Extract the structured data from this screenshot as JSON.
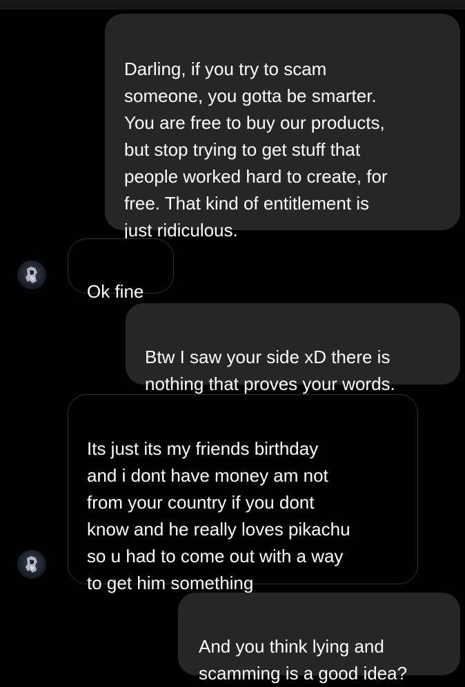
{
  "messages": [
    {
      "id": "m1",
      "direction": "outgoing",
      "text": "Darling, if you try to scam\nsomeone, you gotta be smarter.\nYou are free to buy our products,\nbut stop trying to get stuff that\npeople worked hard to create, for\nfree. That kind of entitlement is\njust ridiculous."
    },
    {
      "id": "m2",
      "direction": "incoming",
      "text": "Ok fine"
    },
    {
      "id": "m3",
      "direction": "outgoing",
      "text": "Btw I saw your side xD there is\nnothing that proves your words."
    },
    {
      "id": "m4",
      "direction": "incoming",
      "text": "Its just its my friends birthday\nand i dont have money am not\nfrom your country if you dont\nknow and he really loves pikachu\nso u had to come out with a way\nto get him something"
    },
    {
      "id": "m5",
      "direction": "outgoing",
      "text": "And you think lying and\nscamming is a good idea?"
    }
  ],
  "icons": {
    "avatar": "contact-avatar-icon"
  },
  "colors": {
    "background": "#000000",
    "outgoing_bubble": "#262626",
    "incoming_border": "#2f2f2f",
    "text": "#ffffff"
  }
}
